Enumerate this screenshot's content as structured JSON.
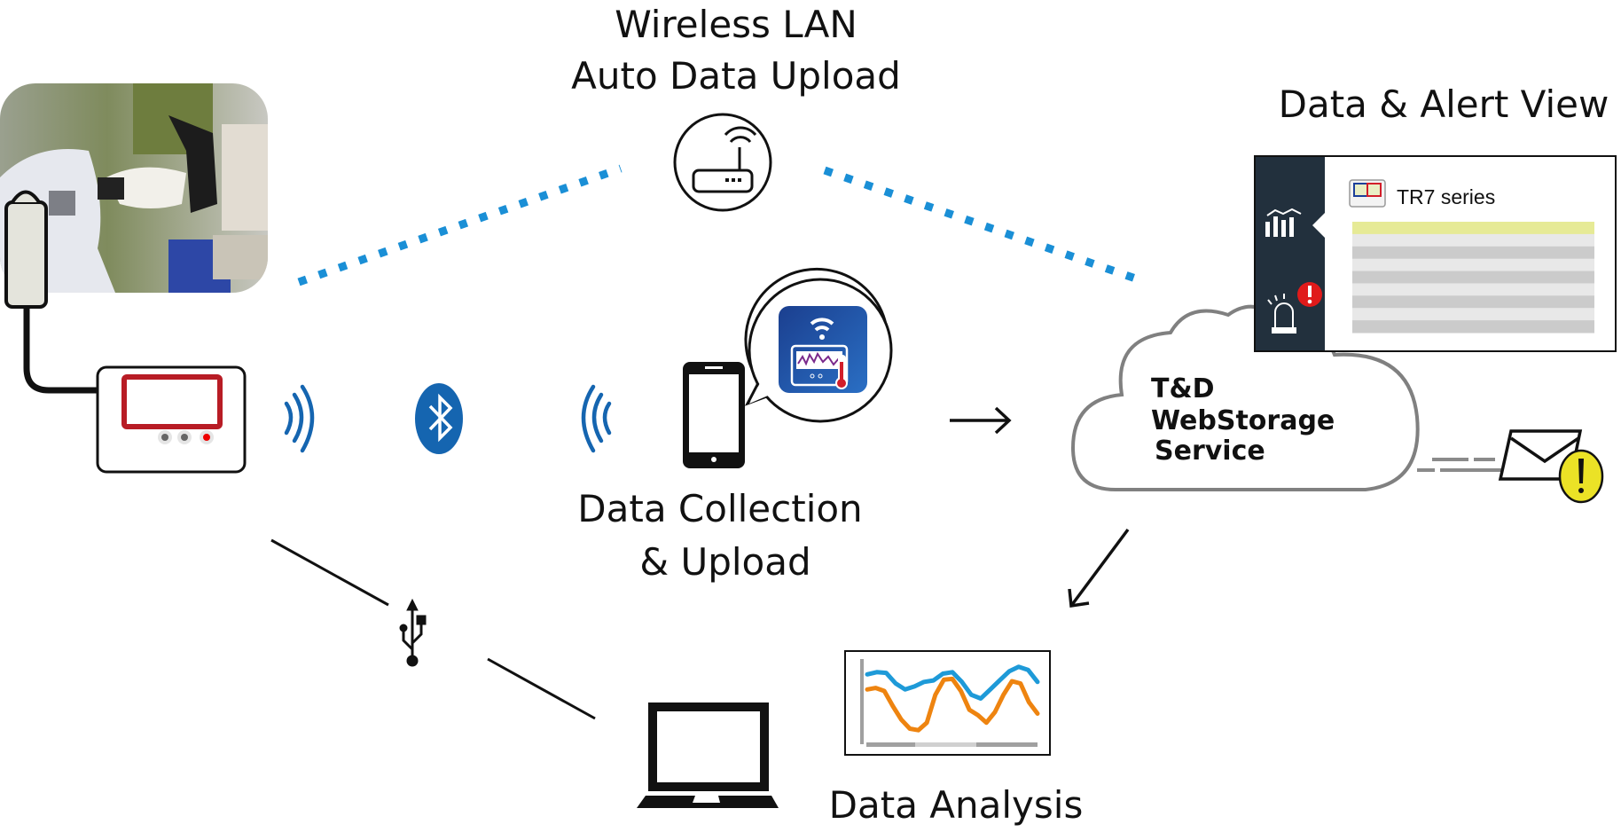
{
  "labels": {
    "wireless_line1": "Wireless LAN",
    "wireless_line2": "Auto Data Upload",
    "alert_view": "Data & Alert View",
    "collection_line1": "Data Collection",
    "collection_line2": "& Upload",
    "analysis": "Data Analysis"
  },
  "cloud": {
    "line1": "T&D",
    "line2": "WebStorage",
    "line3": "Service"
  },
  "panel": {
    "device_name": "TR7 series",
    "sidebar_icons": [
      "graph-icon",
      "alarm-light-icon"
    ],
    "table_rows": 9
  },
  "icons": {
    "router": "wifi-router-icon",
    "bluetooth": "bluetooth-icon",
    "usb": "usb-icon",
    "smartphone": "smartphone-icon",
    "app": "thermometer-app-icon",
    "laptop": "laptop-icon",
    "email_alert": "email-alert-icon"
  },
  "colors": {
    "wifi_dots": "#1a8fd6",
    "radio_waves": "#1565b0",
    "bluetooth": "#1565b0",
    "logger_screen": "#b81c25",
    "panel_sidebar": "#22303d",
    "panel_highlight_row": "#e6ea96",
    "alert_red": "#e01a1a",
    "warning_yellow": "#ebe226",
    "chart_blue": "#1e9ad8",
    "chart_orange": "#ee8410",
    "cloud_outline": "#808080"
  },
  "mini_chart": {
    "series": [
      {
        "name": "blue",
        "color": "#1e9ad8",
        "values": [
          0.82,
          0.85,
          0.84,
          0.7,
          0.62,
          0.66,
          0.72,
          0.74,
          0.83,
          0.85,
          0.72,
          0.55,
          0.5,
          0.62,
          0.74,
          0.86,
          0.92,
          0.88,
          0.72
        ]
      },
      {
        "name": "orange",
        "color": "#ee8410",
        "values": [
          0.62,
          0.64,
          0.6,
          0.4,
          0.22,
          0.1,
          0.08,
          0.18,
          0.55,
          0.75,
          0.76,
          0.6,
          0.35,
          0.28,
          0.18,
          0.32,
          0.55,
          0.73,
          0.7,
          0.45,
          0.3
        ]
      }
    ]
  }
}
